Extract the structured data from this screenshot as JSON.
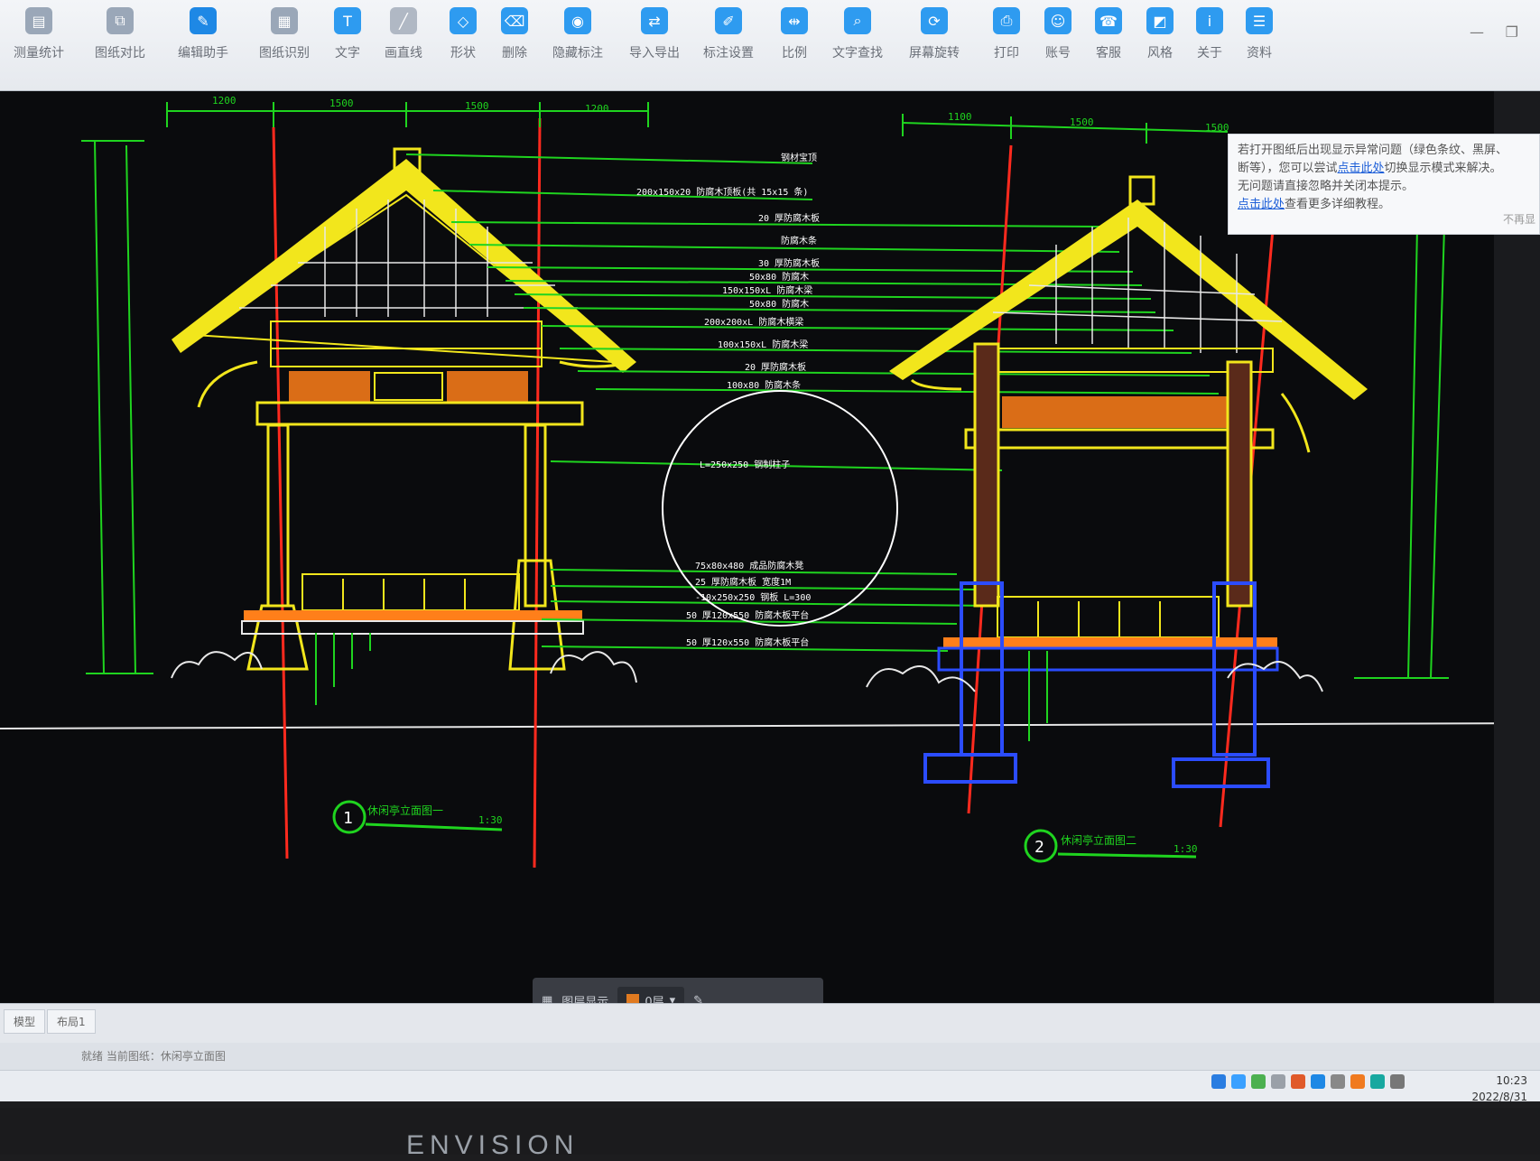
{
  "toolbar": {
    "tools": [
      {
        "label": "测量统计",
        "icon": "measure-stats-icon",
        "color": "#9aa7b8"
      },
      {
        "label": "图纸对比",
        "icon": "compare-icon",
        "color": "#9aa7b8"
      },
      {
        "label": "编辑助手",
        "icon": "edit-assistant-icon",
        "color": "#1e88e5"
      },
      {
        "label": "图纸识别",
        "icon": "recognize-icon",
        "color": "#9aa7b8"
      },
      {
        "label": "文字",
        "icon": "text-icon",
        "color": "#2e9bf0"
      },
      {
        "label": "画直线",
        "icon": "line-icon",
        "color": "#b0b8c4"
      },
      {
        "label": "形状",
        "icon": "shape-icon",
        "color": "#2e9bf0"
      },
      {
        "label": "删除",
        "icon": "eraser-icon",
        "color": "#2e9bf0"
      },
      {
        "label": "隐藏标注",
        "icon": "eye-hide-icon",
        "color": "#2e9bf0"
      },
      {
        "label": "导入导出",
        "icon": "import-export-icon",
        "color": "#2e9bf0"
      },
      {
        "label": "标注设置",
        "icon": "annotation-settings-icon",
        "color": "#2e9bf0"
      },
      {
        "label": "比例",
        "icon": "scale-icon",
        "color": "#2e9bf0"
      },
      {
        "label": "文字查找",
        "icon": "text-search-icon",
        "color": "#2e9bf0"
      },
      {
        "label": "屏幕旋转",
        "icon": "rotate-icon",
        "color": "#2e9bf0"
      },
      {
        "label": "打印",
        "icon": "print-icon",
        "color": "#2e9bf0"
      },
      {
        "label": "账号",
        "icon": "account-icon",
        "color": "#2e9bf0"
      },
      {
        "label": "客服",
        "icon": "headset-icon",
        "color": "#2e9bf0"
      },
      {
        "label": "风格",
        "icon": "style-icon",
        "color": "#2e9bf0"
      },
      {
        "label": "关于",
        "icon": "info-icon",
        "color": "#2e9bf0"
      },
      {
        "label": "资料",
        "icon": "docs-icon",
        "color": "#2e9bf0"
      }
    ]
  },
  "notice": {
    "line1": "若打开图纸后出现显示异常问题（绿色条纹、黑屏、",
    "line2_pre": "断等），您可以尝试",
    "line2_link": "点击此处",
    "line2_post": "切换显示模式来解决。",
    "line3": "无问题请直接忽略并关闭本提示。",
    "line4_link": "点击此处",
    "line4_post": "查看更多详细教程。",
    "close": "不再显"
  },
  "drawing": {
    "label1_num": "1",
    "label1_title": "休闲亭立面图一",
    "label1_scale": "1:30",
    "label2_num": "2",
    "label2_title": "休闲亭立面图二",
    "label2_scale": "1:30",
    "top_dims_left": [
      "1200",
      "1500",
      "1500",
      "1200"
    ],
    "top_dims_right": [
      "1100",
      "1500",
      "1500"
    ],
    "callouts": [
      "钢材宝顶",
      "200x150x20    防腐木顶板(共   15x15   条)",
      "20  厚防腐木板",
      "防腐木条",
      "30  厚防腐木板",
      "50x80   防腐木",
      "150x150xL     防腐木梁",
      "50x80   防腐木",
      "200x200xL     防腐木横梁",
      "100x150xL     防腐木梁",
      "20  厚防腐木板",
      "100x80   防腐木条",
      "L=250x250    钢制柱子",
      "75x80x480     成品防腐木凳",
      "25  厚防腐木板  宽度1M",
      "-10x250x250   钢板  L=300",
      "50  厚120x550   防腐木板平台",
      "50  厚120x550   防腐木板平台"
    ]
  },
  "floatbar": {
    "label": "图层显示",
    "layer": "0层"
  },
  "tabs": [
    "模型",
    "布局1"
  ],
  "statusbar": "就绪 当前图纸：休闲亭立面图",
  "clock": {
    "time": "10:23",
    "date": "2022/8/31"
  },
  "brand": "ENVISION",
  "colors": {
    "grid_green": "#1fd41f",
    "structure_yellow": "#f2e61c",
    "axis_red": "#ff2a1e",
    "hatch_orange": "#ff7f1a",
    "foundation_blue": "#2b4cff"
  }
}
